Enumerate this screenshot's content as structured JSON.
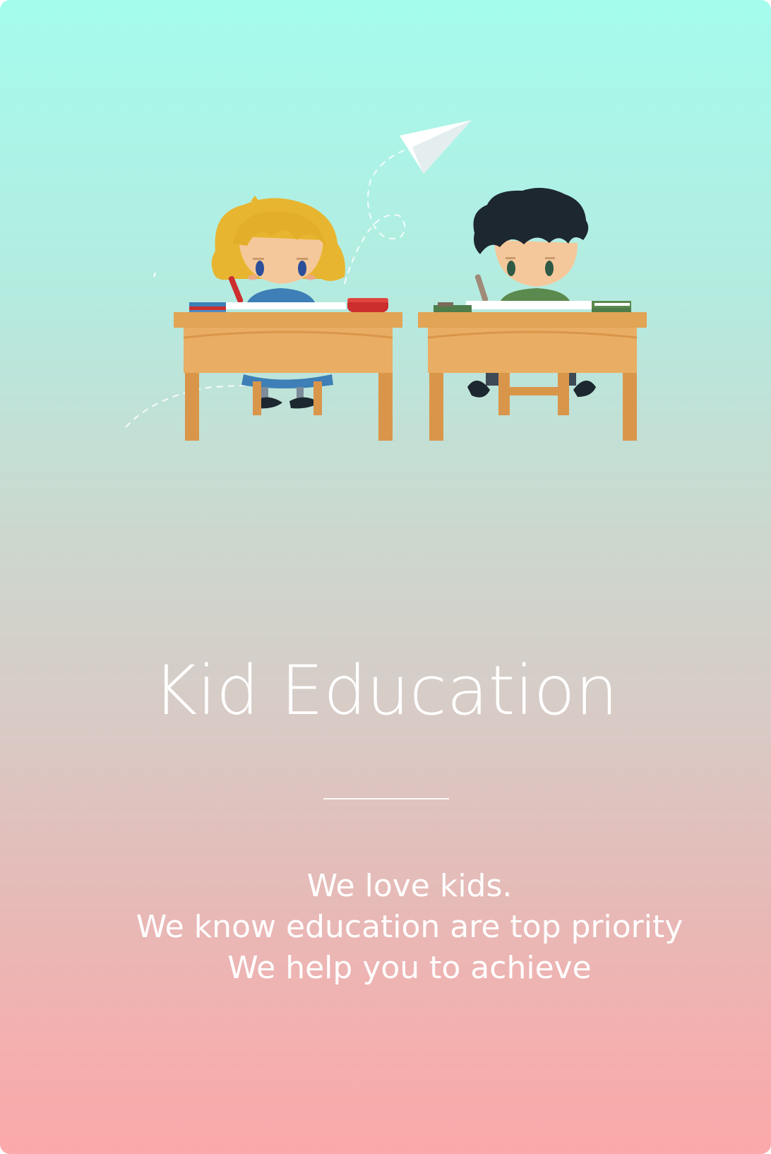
{
  "onboarding": {
    "title": "Kid Education",
    "tagline_lines": [
      "We love kids.",
      "We know education are top priority",
      "We help you to achieve"
    ]
  },
  "colors": {
    "gradient_top": "#a4fced",
    "gradient_bottom": "#fba9aa",
    "text": "#ffffff",
    "desk": "#e2a455",
    "girl_hair": "#e8b530",
    "boy_hair": "#1d2730",
    "girl_shirt": "#3d7fb6",
    "boy_shirt": "#5b8a4e"
  },
  "icons": [
    "paper-plane-icon",
    "girl-student-icon",
    "boy-student-icon",
    "desk-icon",
    "book-icon",
    "pencil-case-icon"
  ]
}
